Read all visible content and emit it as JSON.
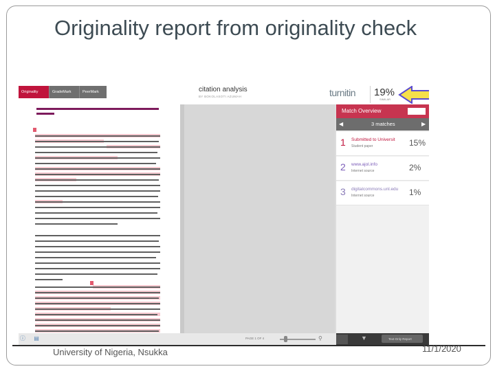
{
  "slide": {
    "title": "Originality report from originality check",
    "footer_left": "University of Nigeria, Nsukka",
    "footer_date": "11/1/2020"
  },
  "app": {
    "tabs": [
      {
        "label": "Originality",
        "active": true
      },
      {
        "label": "GradeMark",
        "active": false
      },
      {
        "label": "PeerMark",
        "active": false
      }
    ],
    "doc_title": "citation analysis",
    "doc_author": "BY BOKOLASOTI AZUMAH",
    "brand": "turnitin",
    "similarity_percent": "19%",
    "similarity_label": "SIMILAR"
  },
  "match_overview": {
    "title": "Match Overview",
    "matches_label": "3 matches",
    "items": [
      {
        "num": "1",
        "source": "Submitted to Universit",
        "type": "Student paper",
        "percent": "15%",
        "color": "#c0143c"
      },
      {
        "num": "2",
        "source": "www.ajol.info",
        "type": "Internet source",
        "percent": "2%",
        "color": "#7b5cb8"
      },
      {
        "num": "3",
        "source": "digitalcommons.unl.edu",
        "type": "Internet source",
        "percent": "1%",
        "color": "#8a7bb8"
      }
    ],
    "footer_button": "Text-Only Report"
  },
  "bottombar": {
    "page_label": "PAGE 1 OF 4"
  },
  "icons": {
    "arrow": "arrow-left-icon",
    "filter": "filter-icon",
    "zoom": "zoom-icon"
  },
  "colors": {
    "accent": "#c73450",
    "arrow_fill": "#f6e04b",
    "arrow_stroke": "#5a4bd0"
  }
}
